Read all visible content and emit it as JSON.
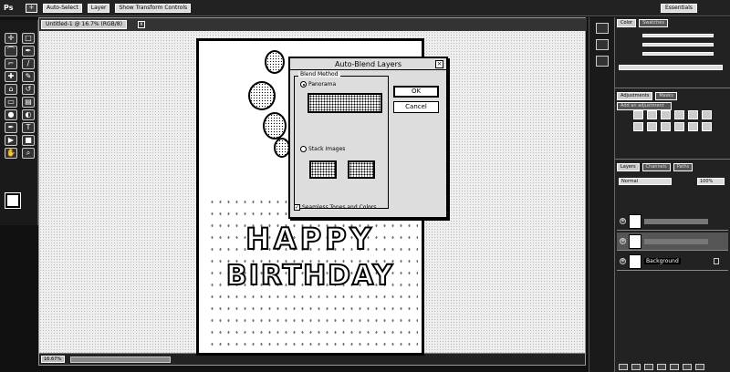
{
  "app": {
    "logo": "Ps",
    "workspace_label": "Essentials"
  },
  "options_bar": {
    "auto_select": "Auto-Select",
    "layer_dropdown": "Layer",
    "transform_controls": "Show Transform Controls"
  },
  "toolbox": {
    "tools": [
      "move",
      "marquee",
      "lasso",
      "quick-select",
      "crop",
      "eyedropper",
      "healing",
      "brush",
      "stamp",
      "history-brush",
      "eraser",
      "gradient",
      "blur",
      "dodge",
      "pen",
      "type",
      "path-select",
      "shape",
      "hand",
      "zoom"
    ]
  },
  "document": {
    "tab_label": "Untitled-1 @ 16.7% (RGB/8)",
    "close_glyph": "x",
    "zoom": "16.67%"
  },
  "card": {
    "line1": "HAPPY",
    "line2": "BIRTHDAY"
  },
  "dialog": {
    "title": "Auto-Blend Layers",
    "group_label": "Blend Method",
    "option_panorama": "Panorama",
    "option_stack": "Stack Images",
    "selected": "Panorama",
    "checkbox_label": "Seamless Tones and Colors",
    "checkbox_checked": true,
    "ok_label": "OK",
    "cancel_label": "Cancel"
  },
  "panels": {
    "color_tabs": [
      "Color",
      "Swatches"
    ],
    "adjust_tabs": [
      "Adjustments",
      "Masks"
    ],
    "adjust_label": "Add an adjustment",
    "layers_tabs": [
      "Layers",
      "Channels",
      "Paths"
    ],
    "blend_mode": "Normal",
    "opacity": "100%",
    "layers": [
      {
        "name": "",
        "selected": false
      },
      {
        "name": "",
        "selected": true
      },
      {
        "name": "Background",
        "selected": false
      }
    ]
  }
}
